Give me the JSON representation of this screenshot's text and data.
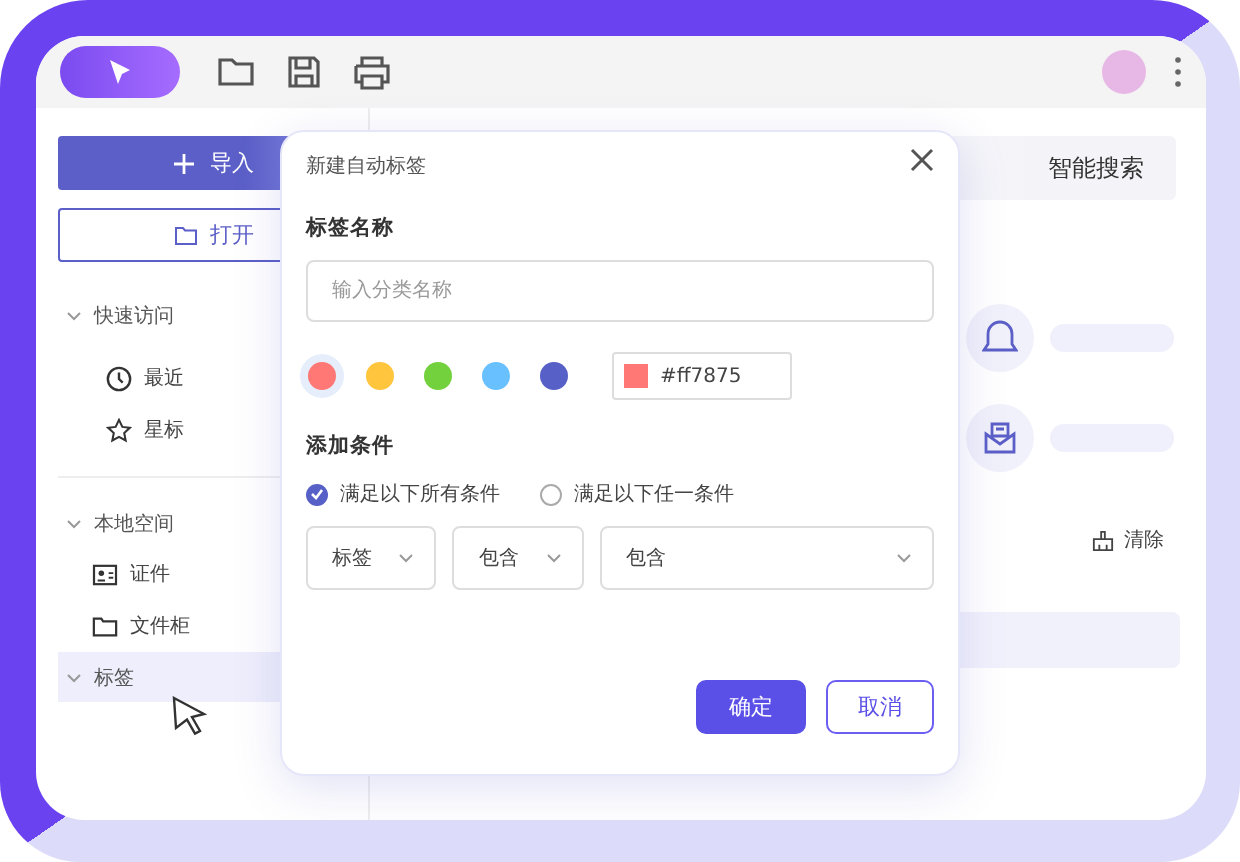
{
  "sidebar": {
    "import_button": "导入",
    "open_button": "打开",
    "sections": [
      {
        "label": "快速访问",
        "selected": false,
        "items": [
          "最近",
          "星标"
        ]
      },
      {
        "label": "本地空间",
        "selected": false,
        "items": [
          "证件",
          "文件柜"
        ]
      },
      {
        "label": "标签",
        "selected": true
      }
    ]
  },
  "main": {
    "search_button": "智能搜索",
    "clear_button": "清除"
  },
  "dialog": {
    "title": "新建自动标签",
    "name_label": "标签名称",
    "name_placeholder": "输入分类名称",
    "colors": [
      {
        "color": "#ff7875",
        "selected": true
      },
      {
        "color": "#ffc53d",
        "selected": false
      },
      {
        "color": "#73d13d",
        "selected": false
      },
      {
        "color": "#69c0ff",
        "selected": false
      },
      {
        "color": "#5660c7",
        "selected": false
      }
    ],
    "hex_value": "#ff7875",
    "conditions_label": "添加条件",
    "match_options": [
      {
        "label": "满足以下所有条件",
        "selected": true
      },
      {
        "label": "满足以下任一条件",
        "selected": false
      }
    ],
    "condition_fields": [
      "标签",
      "包含",
      "包含"
    ],
    "confirm_button": "确定",
    "cancel_button": "取消"
  }
}
